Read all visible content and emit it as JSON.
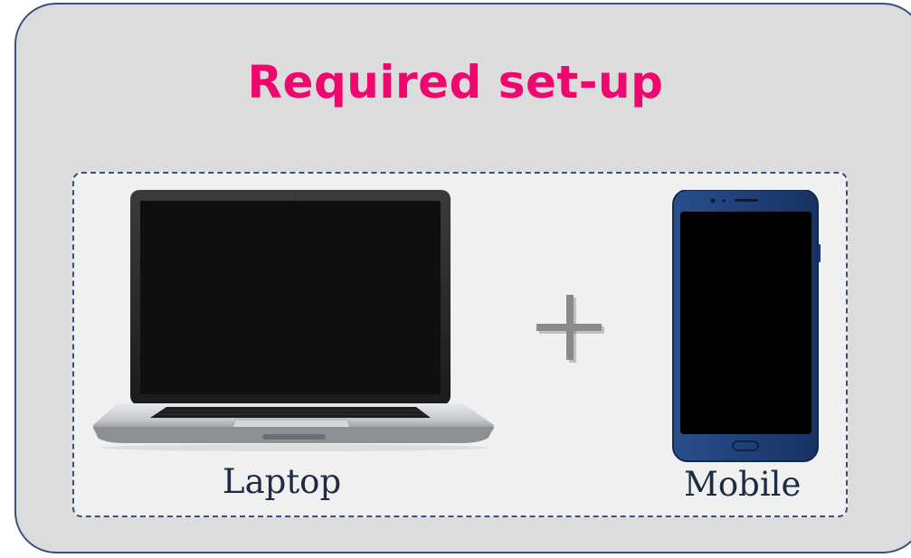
{
  "title": "Required set-up",
  "devices": [
    {
      "name": "laptop",
      "label": "Laptop"
    },
    {
      "name": "mobile",
      "label": "Mobile"
    }
  ],
  "connector_symbol": "+",
  "colors": {
    "title": "#f0066f",
    "card_background": "#dcdcdc",
    "border": "#3c4f7f",
    "inner_box_background": "#f0f0f0",
    "label_text": "#1e2b44",
    "phone_body": "#1f3f78"
  },
  "icons": [
    "laptop-image",
    "plus-icon",
    "mobile-phone-image"
  ]
}
